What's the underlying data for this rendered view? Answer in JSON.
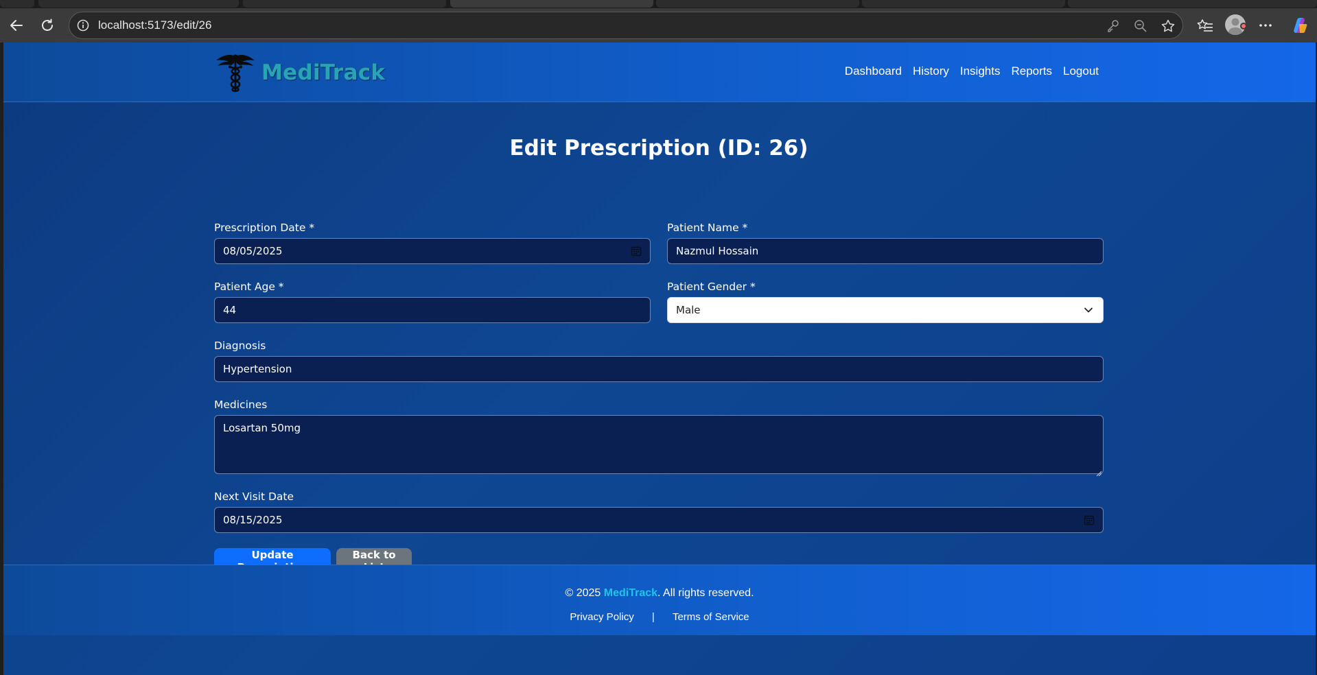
{
  "browser": {
    "url": "localhost:5173/edit/26"
  },
  "navbar": {
    "brand": "MediTrack",
    "links": [
      "Dashboard",
      "History",
      "Insights",
      "Reports",
      "Logout"
    ]
  },
  "form": {
    "title": "Edit Prescription (ID: 26)",
    "prescription_date": {
      "label": "Prescription Date *",
      "value": "08/05/2025"
    },
    "patient_name": {
      "label": "Patient Name *",
      "value": "Nazmul Hossain"
    },
    "patient_age": {
      "label": "Patient Age *",
      "value": "44"
    },
    "patient_gender": {
      "label": "Patient Gender *",
      "value": "Male"
    },
    "diagnosis": {
      "label": "Diagnosis",
      "value": "Hypertension"
    },
    "medicines": {
      "label": "Medicines",
      "value": "Losartan 50mg"
    },
    "next_visit_date": {
      "label": "Next Visit Date",
      "value": "08/15/2025"
    },
    "update_button": "Update Prescription",
    "back_button": "Back to List"
  },
  "footer": {
    "copyright_prefix": "© 2025 ",
    "brand": "MediTrack",
    "copyright_suffix": ". All rights reserved.",
    "privacy": "Privacy Policy",
    "separator": "|",
    "terms": "Terms of Service"
  },
  "colors": {
    "navbar": "#115fcf",
    "background": "#0f4793",
    "input_bg": "#0a1f52",
    "primary_button": "#0d6efd",
    "secondary_button": "#6c757d",
    "brand_text": "#2aa3b8",
    "footer_brand": "#21c4e8"
  },
  "icons": [
    "back-arrow-icon",
    "reload-icon",
    "info-icon",
    "key-icon",
    "zoom-icon",
    "star-icon",
    "favorites-icon",
    "profile-icon",
    "more-icon",
    "copilot-icon",
    "caduceus-logo-icon",
    "calendar-icon",
    "chevron-down-icon"
  ]
}
